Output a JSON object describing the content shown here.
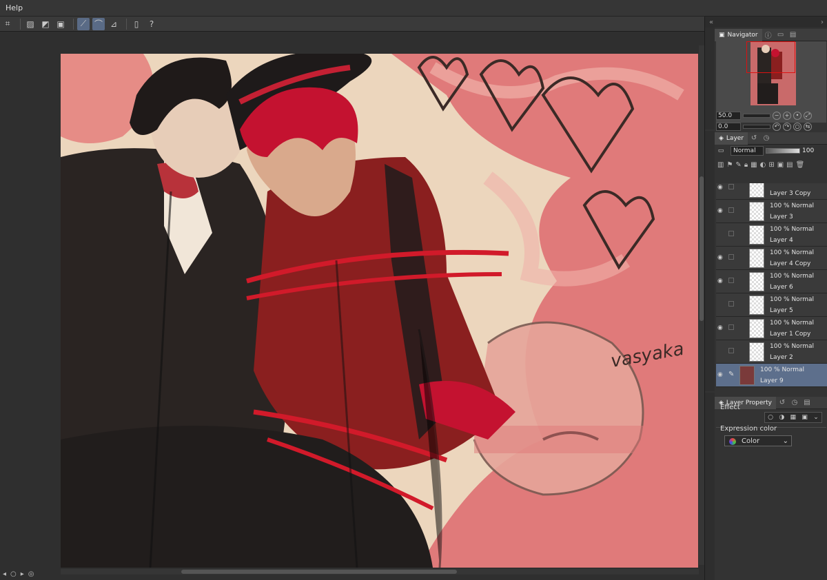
{
  "menu": {
    "items": [
      "Help"
    ]
  },
  "navigator": {
    "tab_label": "Navigator",
    "zoom_value": "50.0",
    "rotation_value": "0.0"
  },
  "layer_panel": {
    "tab_label": "Layer",
    "blend_mode": "Normal",
    "opacity": "100",
    "layers": [
      {
        "mode": "",
        "name": "Layer 3 Copy",
        "selected": false
      },
      {
        "mode": "100 % Normal",
        "name": "Layer 3",
        "selected": false
      },
      {
        "mode": "100 % Normal",
        "name": "Layer 4",
        "selected": false
      },
      {
        "mode": "100 % Normal",
        "name": "Layer 4 Copy",
        "selected": false
      },
      {
        "mode": "100 % Normal",
        "name": "Layer 6",
        "selected": false
      },
      {
        "mode": "100 % Normal",
        "name": "Layer 5",
        "selected": false
      },
      {
        "mode": "100 % Normal",
        "name": "Layer 1 Copy",
        "selected": false
      },
      {
        "mode": "100 % Normal",
        "name": "Layer 2",
        "selected": false
      },
      {
        "mode": "100 % Normal",
        "name": "Layer 9",
        "selected": true
      }
    ]
  },
  "layer_property": {
    "tab_label": "Layer Property",
    "effect_label": "Effect",
    "expression_label": "Expression color",
    "expression_value": "Color"
  },
  "canvas": {
    "signature": "vasyaka"
  },
  "colors": {
    "panel_bg": "#333333",
    "selected_layer": "#5d6f8c",
    "canvas_pink": "#e07a7a",
    "canvas_paper": "#ecd6bd",
    "ink_dark": "#2a2422",
    "shirt_red": "#8a1f1f",
    "stroke_red": "#d11a2a"
  }
}
